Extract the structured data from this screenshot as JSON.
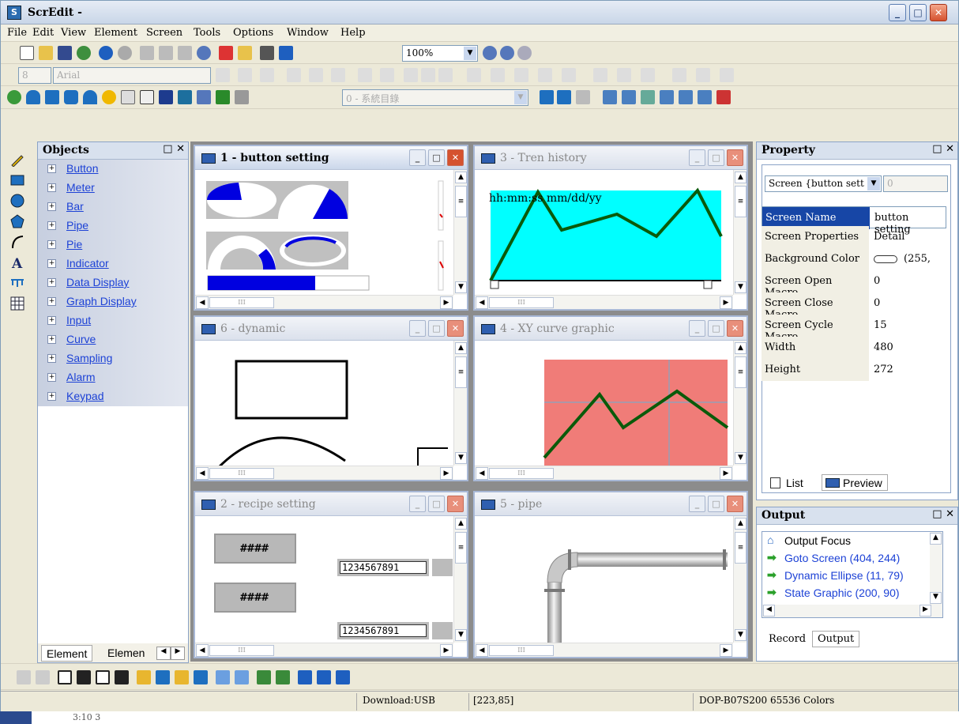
{
  "app": {
    "title": "ScrEdit -",
    "icon_text": "S"
  },
  "menu": [
    "File",
    "Edit",
    "View",
    "Element",
    "Screen",
    "Tools",
    "Options",
    "Window",
    "Help"
  ],
  "toolbar": {
    "zoom": "100%",
    "font_size": "8",
    "font_name": "Arial",
    "layer": "0 - 系統目錄"
  },
  "objects_panel": {
    "title": "Objects",
    "items": [
      "Button",
      "Meter",
      "Bar",
      "Pipe",
      "Pie",
      "Indicator",
      "Data Display",
      "Graph Display",
      "Input",
      "Curve",
      "Sampling",
      "Alarm",
      "Keypad"
    ],
    "tabs": [
      "Element",
      "Elemen"
    ]
  },
  "windows": {
    "w1": {
      "title": "1 - button setting"
    },
    "w3": {
      "title": "3 - Tren history",
      "overlay_text": "hh:mm:ss  mm/dd/yy"
    },
    "w6": {
      "title": "6 - dynamic"
    },
    "w4": {
      "title": "4 - XY curve graphic"
    },
    "w2": {
      "title": "2 - recipe setting",
      "btn1": "####",
      "btn2": "####",
      "num1": "1234567891",
      "num2": "1234567891"
    },
    "w5": {
      "title": "5 - pipe"
    }
  },
  "property_panel": {
    "title": "Property",
    "selector": "Screen {button sett",
    "selector2": "0",
    "rows": [
      {
        "key": "Screen Name",
        "value": "button setting"
      },
      {
        "key": "Screen Properties",
        "value": "Detail"
      },
      {
        "key": "Background Color",
        "value": "(255,"
      },
      {
        "key": "Screen Open Macro",
        "value": "0"
      },
      {
        "key": "Screen Close Macro",
        "value": "0"
      },
      {
        "key": "Screen Cycle Macro",
        "value": "15"
      },
      {
        "key": "Width",
        "value": "480"
      },
      {
        "key": "Height",
        "value": "272"
      }
    ],
    "tabs": [
      "List",
      "Preview"
    ]
  },
  "output_panel": {
    "title": "Output",
    "items": [
      "Output Focus",
      "Goto Screen (404, 244)",
      "Dynamic Ellipse (11, 79)",
      "State Graphic (200, 90)"
    ],
    "tabs": [
      "Record",
      "Output"
    ]
  },
  "status": {
    "download": "Download:USB",
    "coords": "[223,85]",
    "device": "DOP-B07S200 65536 Colors"
  },
  "taskbar_text": "3:10 3"
}
